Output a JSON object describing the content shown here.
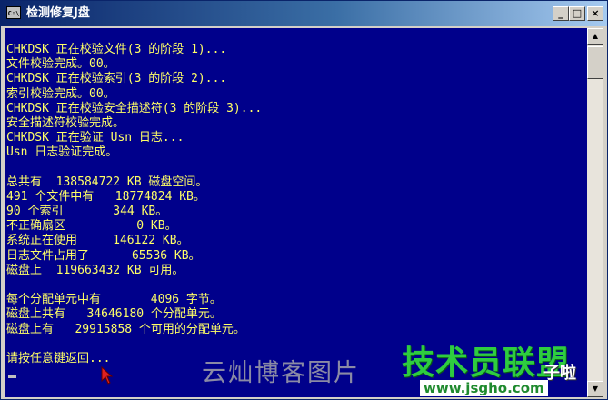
{
  "window": {
    "title": "检测修复J盘",
    "icon_text": "C:\\",
    "minimize_label": "_",
    "maximize_label": "□",
    "close_label": "×"
  },
  "console": {
    "text_color": "#ffff66",
    "background_color": "#00008b",
    "lines": [
      "CHKDSK 正在校验文件(3 的阶段 1)...",
      "文件校验完成。00。",
      "CHKDSK 正在校验索引(3 的阶段 2)...",
      "索引校验完成。00。",
      "CHKDSK 正在校验安全描述符(3 的阶段 3)...",
      "安全描述符校验完成。",
      "CHKDSK 正在验证 Usn 日志...",
      "Usn 日志验证完成。",
      "",
      "总共有  138584722 KB 磁盘空间。",
      "491 个文件中有   18774824 KB。",
      "90 个索引       344 KB。",
      "不正确扇区          0 KB。",
      "系统正在使用     146122 KB。",
      "日志文件占用了      65536 KB。",
      "磁盘上  119663432 KB 可用。",
      "",
      "每个分配单元中有       4096 字节。",
      "磁盘上共有   34646180 个分配单元。",
      "磁盘上有   29915858 个可用的分配单元。",
      "",
      "请按任意键返回..."
    ]
  },
  "scrollbar": {
    "up_arrow": "▲",
    "down_arrow": "▼"
  },
  "watermarks": {
    "blog": "云灿博客图片",
    "site": "技术员联盟",
    "url": "www.jsgho.com",
    "corner": "子啦"
  }
}
